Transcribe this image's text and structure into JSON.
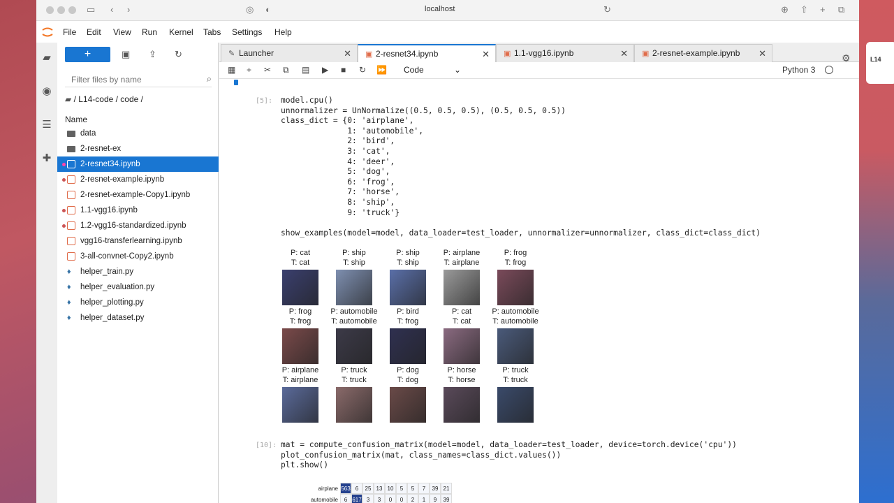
{
  "browser": {
    "url": "localhost"
  },
  "menu": [
    "File",
    "Edit",
    "View",
    "Run",
    "Kernel",
    "Tabs",
    "Settings",
    "Help"
  ],
  "filebrowser": {
    "new_label": "+",
    "filter_placeholder": "Filter files by name",
    "breadcrumb": "/ L14-code / code /",
    "column_name": "Name",
    "files": [
      {
        "name": "data",
        "type": "folder",
        "running": false,
        "selected": false
      },
      {
        "name": "2-resnet-ex",
        "type": "folder",
        "running": false,
        "selected": false
      },
      {
        "name": "2-resnet34.ipynb",
        "type": "notebook",
        "running": true,
        "selected": true
      },
      {
        "name": "2-resnet-example.ipynb",
        "type": "notebook",
        "running": true,
        "selected": false
      },
      {
        "name": "2-resnet-example-Copy1.ipynb",
        "type": "notebook",
        "running": false,
        "selected": false
      },
      {
        "name": "1.1-vgg16.ipynb",
        "type": "notebook",
        "running": true,
        "selected": false
      },
      {
        "name": "1.2-vgg16-standardized.ipynb",
        "type": "notebook",
        "running": true,
        "selected": false
      },
      {
        "name": "vgg16-transferlearning.ipynb",
        "type": "notebook",
        "running": false,
        "selected": false
      },
      {
        "name": "3-all-convnet-Copy2.ipynb",
        "type": "notebook",
        "running": false,
        "selected": false
      },
      {
        "name": "helper_train.py",
        "type": "python",
        "running": false,
        "selected": false
      },
      {
        "name": "helper_evaluation.py",
        "type": "python",
        "running": false,
        "selected": false
      },
      {
        "name": "helper_plotting.py",
        "type": "python",
        "running": false,
        "selected": false
      },
      {
        "name": "helper_dataset.py",
        "type": "python",
        "running": false,
        "selected": false
      }
    ]
  },
  "tabs": [
    {
      "label": "Launcher",
      "active": false
    },
    {
      "label": "2-resnet34.ipynb",
      "active": true
    },
    {
      "label": "1.1-vgg16.ipynb",
      "active": false
    },
    {
      "label": "2-resnet-example.ipynb",
      "active": false
    }
  ],
  "toolbar": {
    "cell_type": "Code",
    "kernel": "Python 3"
  },
  "cells": [
    {
      "prompt": "[5]:",
      "lines": [
        "model.cpu()",
        "unnormalizer = UnNormalize((0.5, 0.5, 0.5), (0.5, 0.5, 0.5))",
        "class_dict = {0: 'airplane',",
        "              1: 'automobile',",
        "              2: 'bird',",
        "              3: 'cat',",
        "              4: 'deer',",
        "              5: 'dog',",
        "              6: 'frog',",
        "              7: 'horse',",
        "              8: 'ship',",
        "              9: 'truck'}",
        "",
        "show_examples(model=model, data_loader=test_loader, unnormalizer=unnormalizer, class_dict=class_dict)"
      ]
    },
    {
      "prompt": "[10]:",
      "lines": [
        "mat = compute_confusion_matrix(model=model, data_loader=test_loader, device=torch.device('cpu'))",
        "plot_confusion_matrix(mat, class_names=class_dict.values())",
        "plt.show()"
      ]
    }
  ],
  "examples": [
    {
      "p": "P: cat",
      "t": "T: cat",
      "color": "#3a3f6e"
    },
    {
      "p": "P: ship",
      "t": "T: ship",
      "color": "#7e8fb0"
    },
    {
      "p": "P: ship",
      "t": "T: ship",
      "color": "#5a6fa8"
    },
    {
      "p": "P: airplane",
      "t": "T: airplane",
      "color": "#9a9a9a"
    },
    {
      "p": "P: frog",
      "t": "T: frog",
      "color": "#7a4a5a"
    },
    {
      "p": "P: frog",
      "t": "T: frog",
      "color": "#7a4a4a"
    },
    {
      "p": "P: automobile",
      "t": "T: automobile",
      "color": "#3c3a48"
    },
    {
      "p": "P: bird",
      "t": "T: frog",
      "color": "#2f3050"
    },
    {
      "p": "P: cat",
      "t": "T: cat",
      "color": "#8a6a80"
    },
    {
      "p": "P: automobile",
      "t": "T: automobile",
      "color": "#4a5a7a"
    },
    {
      "p": "P: airplane",
      "t": "T: airplane",
      "color": "#5a6a9a"
    },
    {
      "p": "P: truck",
      "t": "T: truck",
      "color": "#8a6a6a"
    },
    {
      "p": "P: dog",
      "t": "T: dog",
      "color": "#6a4a48"
    },
    {
      "p": "P: horse",
      "t": "T: horse",
      "color": "#5a4a5a"
    },
    {
      "p": "P: truck",
      "t": "T: truck",
      "color": "#3a4a6a"
    }
  ],
  "confusion": {
    "row_labels": [
      "airplane",
      "automobile"
    ],
    "rows": [
      [
        "563",
        "6",
        "25",
        "13",
        "10",
        "5",
        "5",
        "7",
        "39",
        "21"
      ],
      [
        "6",
        "617",
        "3",
        "3",
        "0",
        "0",
        "2",
        "1",
        "9",
        "39"
      ]
    ]
  }
}
